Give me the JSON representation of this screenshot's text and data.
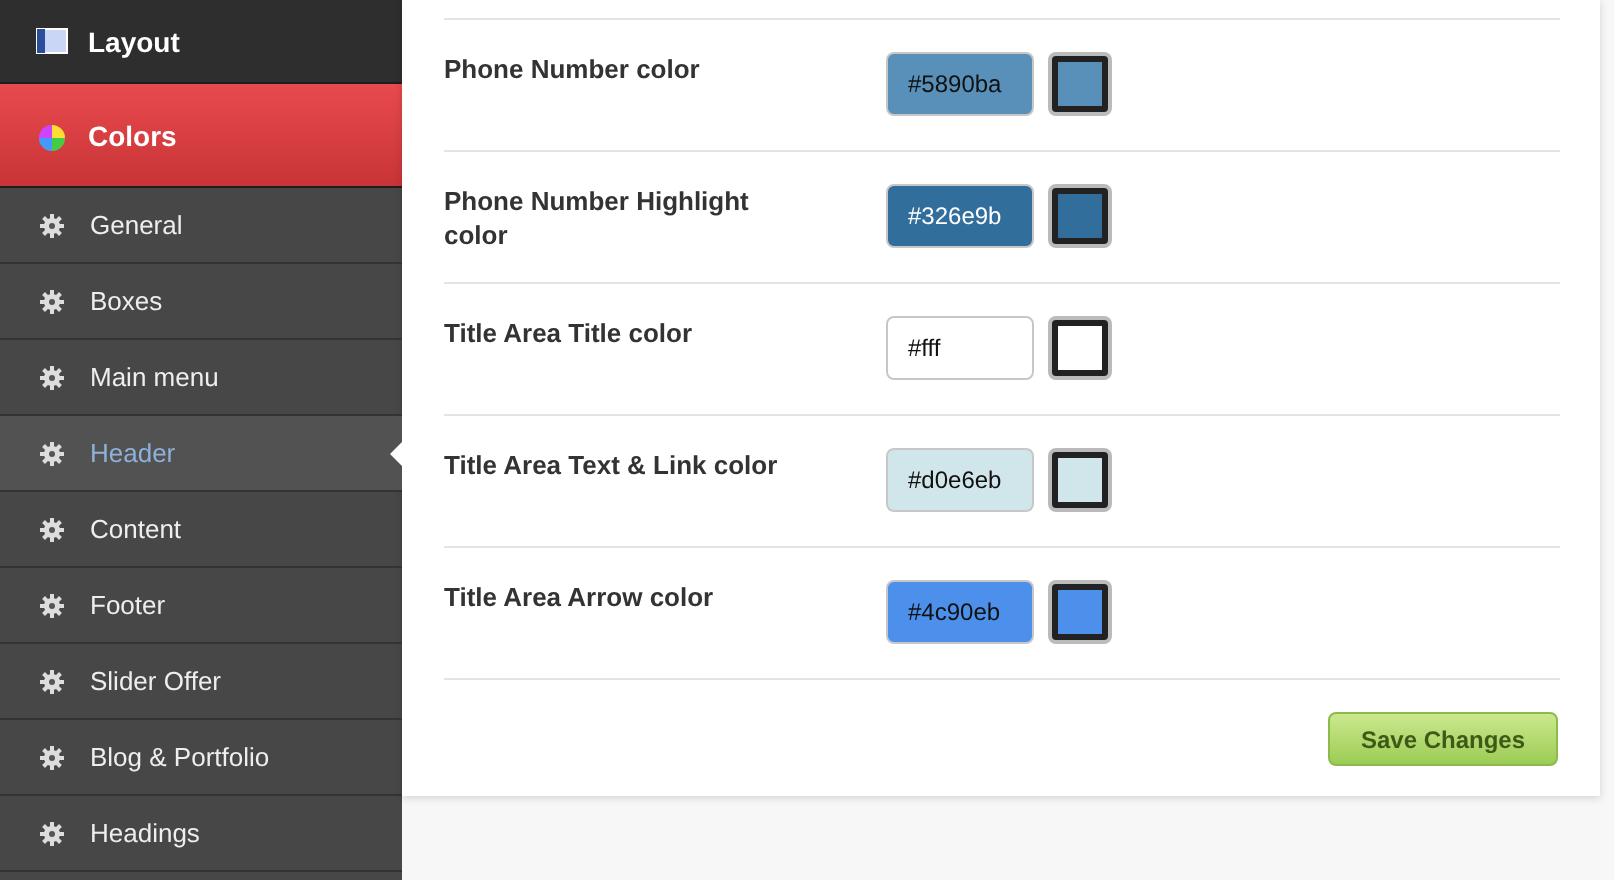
{
  "sidebar": {
    "sections": [
      {
        "label": "Layout",
        "selected": false
      },
      {
        "label": "Colors",
        "selected": true
      }
    ],
    "items": [
      {
        "label": "General",
        "selected": false
      },
      {
        "label": "Boxes",
        "selected": false
      },
      {
        "label": "Main menu",
        "selected": false
      },
      {
        "label": "Header",
        "selected": true
      },
      {
        "label": "Content",
        "selected": false
      },
      {
        "label": "Footer",
        "selected": false
      },
      {
        "label": "Slider Offer",
        "selected": false
      },
      {
        "label": "Blog & Portfolio",
        "selected": false
      },
      {
        "label": "Headings",
        "selected": false
      }
    ]
  },
  "settings": [
    {
      "label": "Phone Number color",
      "value": "#5890ba",
      "color": "#5890ba"
    },
    {
      "label": "Phone Number Highlight color",
      "value": "#326e9b",
      "color": "#326e9b"
    },
    {
      "label": "Title Area Title color",
      "value": "#fff",
      "color": "#ffffff"
    },
    {
      "label": "Title Area Text & Link color",
      "value": "#d0e6eb",
      "color": "#d0e6eb"
    },
    {
      "label": "Title Area Arrow color",
      "value": "#4c90eb",
      "color": "#4c90eb"
    }
  ],
  "save_button": "Save Changes"
}
